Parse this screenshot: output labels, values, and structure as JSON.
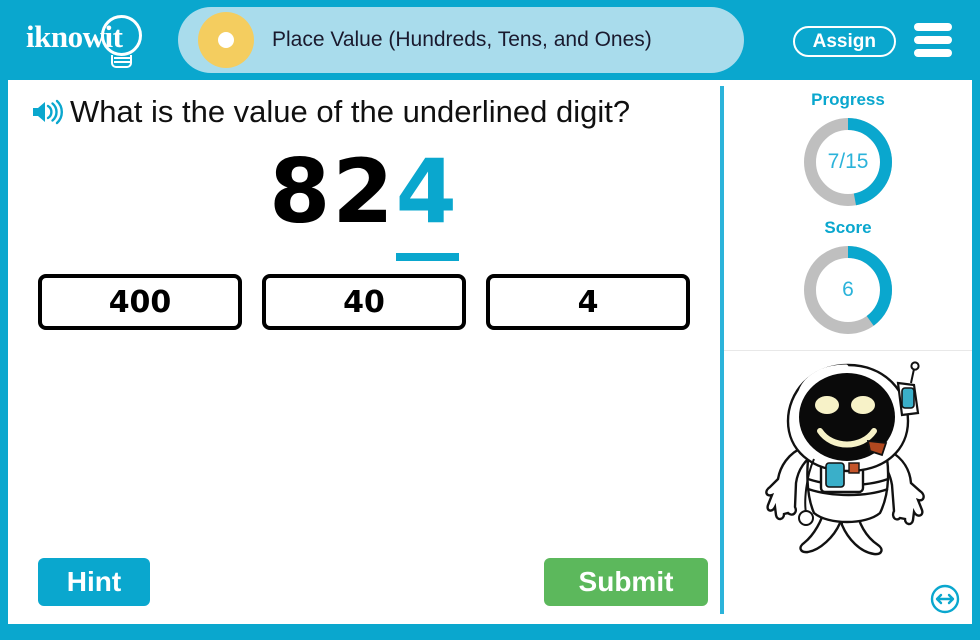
{
  "brand": {
    "logo_text": "iknowit",
    "logo_icon": "lightbulb-icon",
    "primary_color": "#0aa7ce",
    "title_pill_color": "#a9dcec",
    "accent_yellow": "#f4cd5f",
    "submit_green": "#5cb85c"
  },
  "header": {
    "lesson_title": "Place Value (Hundreds, Tens, and Ones)",
    "assign_label": "Assign",
    "menu_icon": "hamburger-menu-icon",
    "title_dot_icon": "lesson-bullet-icon"
  },
  "question": {
    "speaker_icon": "speaker-audio-icon",
    "prompt": "What is the value of the underlined digit?",
    "number": {
      "plain_digits": "82",
      "highlighted_digit": "4",
      "full_value": "824",
      "highlight_color": "#0aa7ce"
    },
    "answers": [
      {
        "label": "400"
      },
      {
        "label": "40"
      },
      {
        "label": "4"
      }
    ]
  },
  "actions": {
    "hint_label": "Hint",
    "submit_label": "Submit"
  },
  "sidebar": {
    "progress": {
      "label": "Progress",
      "value_text": "7/15",
      "current": 7,
      "total": 15,
      "percent": 47
    },
    "score": {
      "label": "Score",
      "value_text": "6",
      "percent": 40
    },
    "mascot_icon": "astronaut-mascot-icon",
    "resize_icon": "resize-expand-icon"
  }
}
